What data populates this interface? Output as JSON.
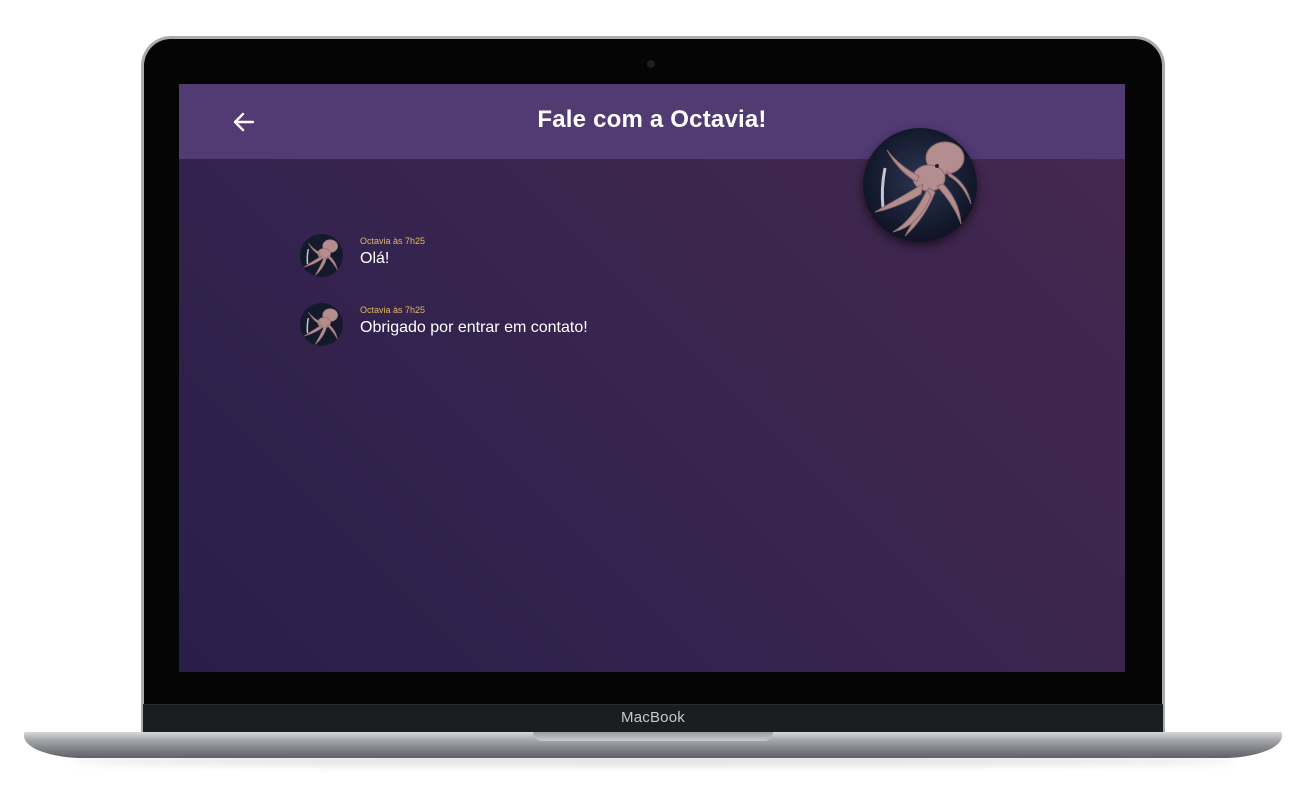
{
  "device": {
    "brand": "MacBook"
  },
  "header": {
    "back_icon": "arrow-left-icon",
    "title": "Fale com a Octavia!",
    "avatar_icon": "octopus-avatar"
  },
  "messages": [
    {
      "meta": "Octavia às 7h25",
      "text": "Olá!"
    },
    {
      "meta": "Octavia às 7h25",
      "text": "Obrigado por entrar em contato!"
    }
  ],
  "colors": {
    "topbar": "#523a73",
    "background_start": "#2a1e48",
    "background_end": "#46284f",
    "meta_text": "#e1b869",
    "message_text": "#ffffff"
  }
}
